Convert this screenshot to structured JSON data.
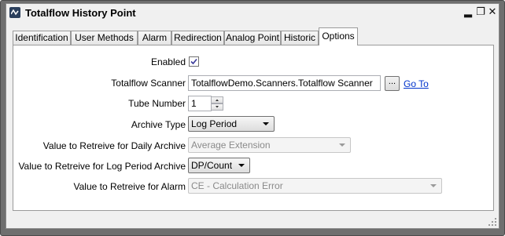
{
  "window": {
    "title": "Totalflow History Point"
  },
  "tabs": [
    {
      "label": "Identification"
    },
    {
      "label": "User Methods"
    },
    {
      "label": "Alarm"
    },
    {
      "label": "Redirection"
    },
    {
      "label": "Analog Point"
    },
    {
      "label": "Historic"
    },
    {
      "label": "Options"
    }
  ],
  "active_tab": "Options",
  "form": {
    "enabled": {
      "label": "Enabled",
      "checked": true
    },
    "scanner": {
      "label": "Totalflow Scanner",
      "value": "TotalflowDemo.Scanners.Totalflow Scanner",
      "browse": "...",
      "goto": "Go To"
    },
    "tube": {
      "label": "Tube Number",
      "value": "1"
    },
    "archive": {
      "label": "Archive Type",
      "value": "Log Period"
    },
    "daily": {
      "label": "Value to Retreive for Daily Archive",
      "value": "Average Extension"
    },
    "logperiod": {
      "label": "Value to Retreive for Log Period Archive",
      "value": "DP/Count"
    },
    "alarm": {
      "label": "Value to Retreive for Alarm",
      "value": "CE - Calculation Error"
    }
  },
  "colors": {
    "frame": "#6f6f6f",
    "window": "#f0f0f0",
    "link": "#0033cc"
  }
}
